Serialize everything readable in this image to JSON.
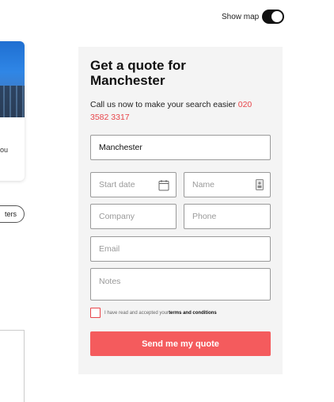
{
  "map_toggle": {
    "label": "Show map",
    "on": true
  },
  "left_partial": {
    "snippet_text": "ou",
    "filters_label": "ters"
  },
  "quote": {
    "title": "Get a quote for Manchester",
    "subtitle_text": "Call us now to make your search easier ",
    "phone": "020 3582 3317",
    "fields": {
      "location_value": "Manchester",
      "start_date_placeholder": "Start date",
      "name_placeholder": "Name",
      "company_placeholder": "Company",
      "phone_placeholder": "Phone",
      "email_placeholder": "Email",
      "notes_placeholder": "Notes"
    },
    "terms_prefix": "I have read and accepted your ",
    "terms_link": "terms and conditions",
    "submit_label": "Send me my quote"
  },
  "colors": {
    "accent": "#f45b5d",
    "phone_link": "#e8454a",
    "panel_bg": "#f4f4f4"
  },
  "icons": {
    "start_date": "calendar-icon",
    "name": "contact-card-icon"
  }
}
